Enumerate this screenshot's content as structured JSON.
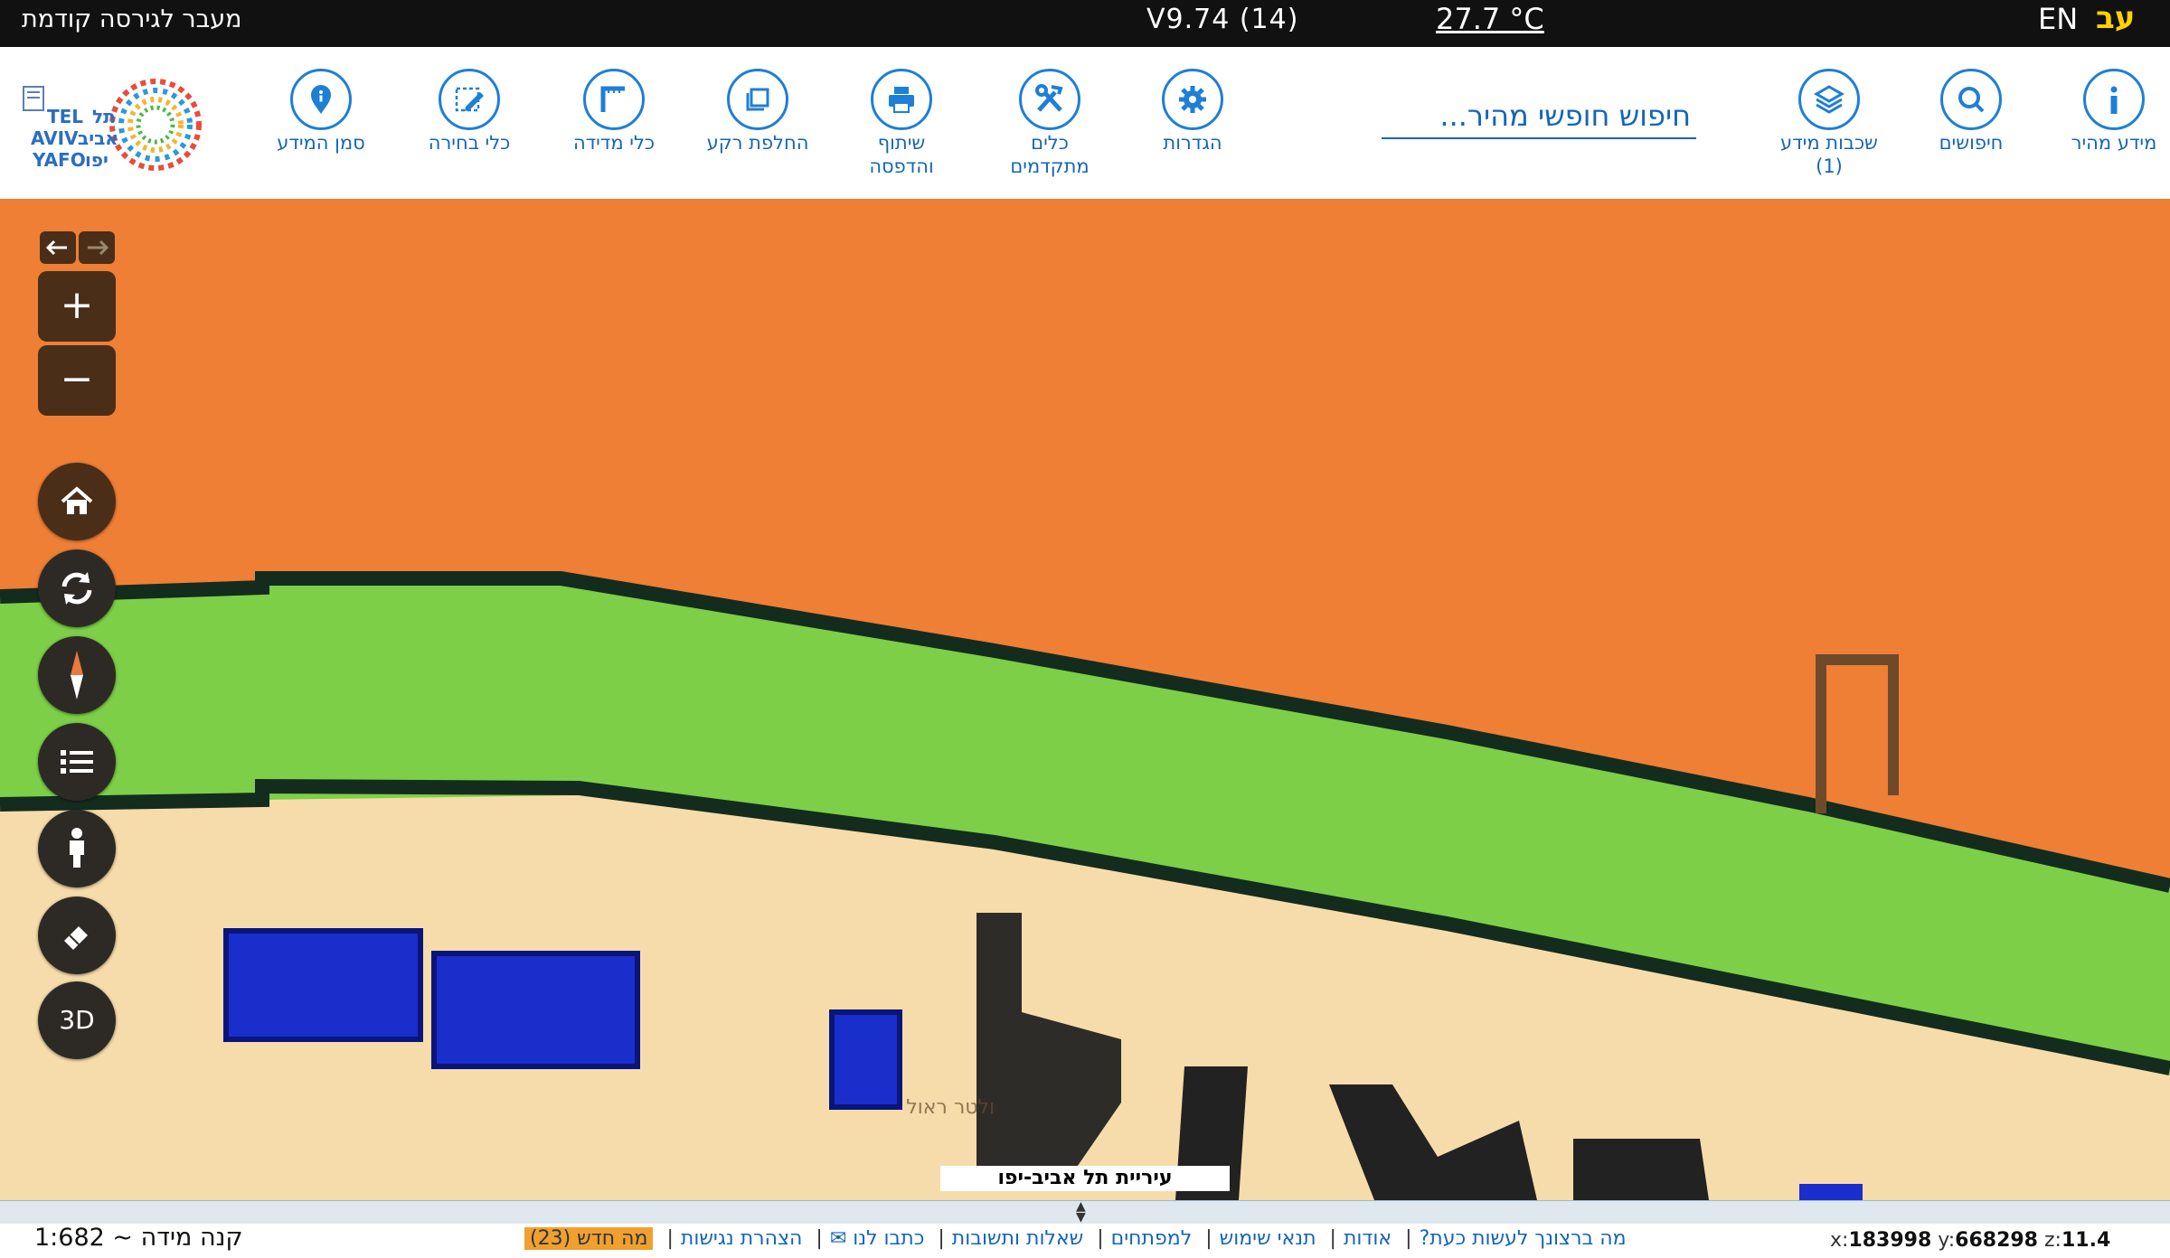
{
  "topbar": {
    "prev_version_link": "מעבר לגירסה קודמת",
    "version": "V9.74 (14)",
    "temperature": "27.7 °C",
    "lang_en": "EN",
    "lang_he": "עב"
  },
  "toolbar": {
    "search_placeholder": "חיפוש חופשי מהיר...",
    "tools": [
      {
        "label": "מידע מהיר",
        "icon": "info-icon"
      },
      {
        "label": "חיפושים",
        "icon": "magnifier-icon"
      },
      {
        "label": "שכבות מידע\n(1)",
        "icon": "layers-icon"
      },
      {
        "label": "הגדרות",
        "icon": "gear-icon"
      },
      {
        "label": "כלים\nמתקדמים",
        "icon": "tools-icon"
      },
      {
        "label": "שיתוף\nוהדפסה",
        "icon": "printer-icon"
      },
      {
        "label": "החלפת רקע",
        "icon": "basemap-icon"
      },
      {
        "label": "כלי מדידה",
        "icon": "ruler-icon"
      },
      {
        "label": "כלי בחירה",
        "icon": "select-icon"
      },
      {
        "label": "סמן המידע",
        "icon": "marker-icon"
      }
    ],
    "logo_text": "TEL AVIV YAFO תל אביב יפו"
  },
  "map": {
    "city_label": "עיריית תל אביב-יפו",
    "street_label": "ולטר ראול",
    "controls": {
      "zoom_in": "+",
      "zoom_out": "−",
      "three_d": "3D"
    },
    "colors": {
      "orange": "#ee7f35",
      "green": "#7ccf47",
      "sand": "#f6dcaa",
      "blue": "#1a2ecc",
      "dark": "#142c1e"
    }
  },
  "footer": {
    "scale": "קנה מידה ~ 1:682",
    "links": [
      "מה ברצונך לעשות כעת?",
      "אודות",
      "תנאי שימוש",
      "למפתחים",
      "שאלות ותשובות",
      "כתבו לנו ✉",
      "הצהרת נגישות"
    ],
    "whats_new": "מה חדש (23)",
    "coords": {
      "x_label": "x:",
      "x": "183998",
      "y_label": "y:",
      "y": "668298",
      "z_label": "z:",
      "z": "11.4"
    }
  }
}
